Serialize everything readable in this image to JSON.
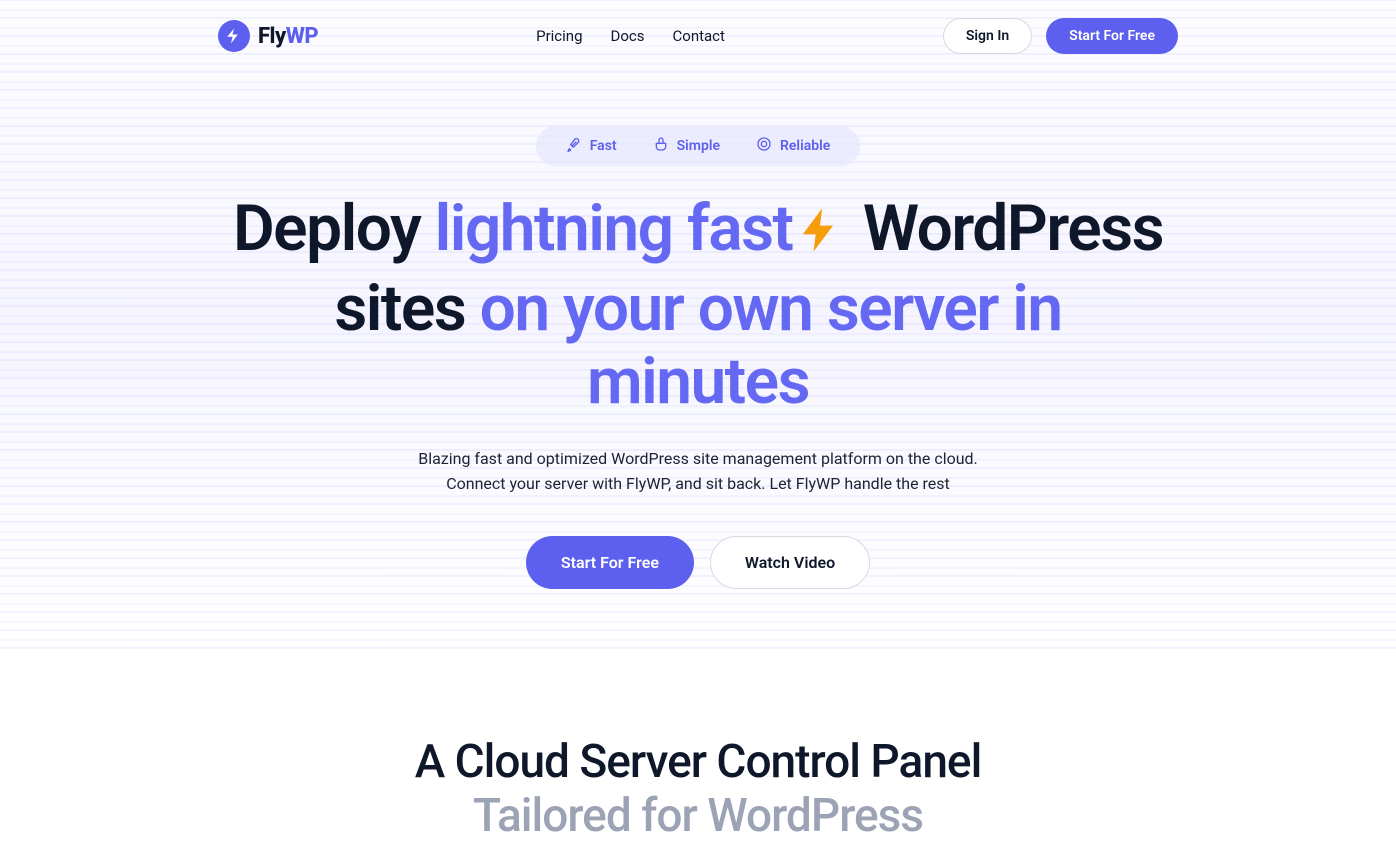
{
  "brand": {
    "name_a": "Fly",
    "name_b": "WP"
  },
  "nav": {
    "links": {
      "pricing": "Pricing",
      "docs": "Docs",
      "contact": "Contact"
    },
    "sign_in": "Sign In",
    "start_free": "Start For Free"
  },
  "chips": {
    "fast": "Fast",
    "simple": "Simple",
    "reliable": "Reliable"
  },
  "hero": {
    "t1": "Deploy ",
    "t2": "lightning fast",
    "t3": " WordPress sites ",
    "t4": "on your own server in minutes",
    "sub1": "Blazing fast and optimized WordPress site management platform on the cloud.",
    "sub2": "Connect your server with FlyWP, and sit back. Let FlyWP handle the rest",
    "cta_primary": "Start For Free",
    "cta_secondary": "Watch Video"
  },
  "section2": {
    "line1": "A Cloud Server Control Panel",
    "line2": "Tailored for WordPress"
  },
  "colors": {
    "accent": "#5d5fef",
    "bolt": "#f59e0b"
  }
}
